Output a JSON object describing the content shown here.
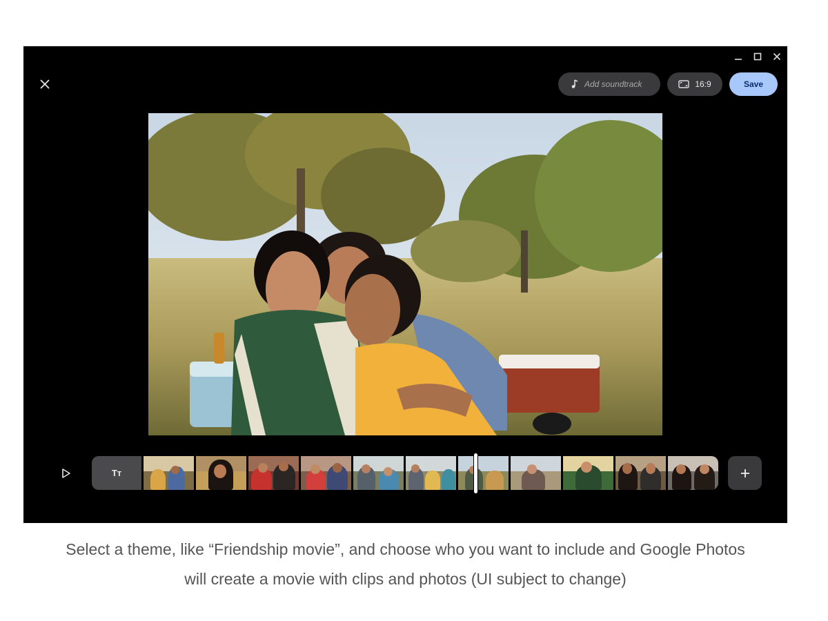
{
  "window": {
    "minimize_icon": "minimize-icon",
    "maximize_icon": "maximize-icon",
    "close_icon": "close-icon"
  },
  "editor": {
    "close_icon": "close-icon"
  },
  "toolbar": {
    "soundtrack_label": "Add soundtrack",
    "soundtrack_icon": "music-note-icon",
    "aspect_label": "16:9",
    "aspect_icon": "aspect-ratio-icon",
    "save_label": "Save"
  },
  "preview": {
    "description_icon": "photo"
  },
  "timeline": {
    "play_icon": "play-icon",
    "text_clip_label": "Tт",
    "clip_count": 11,
    "add_icon": "plus-icon"
  },
  "colors": {
    "app_background": "#000000",
    "save_button": "#a8c7fa",
    "pill_background": "#3a3a3c",
    "caption_text": "#555555"
  },
  "caption": {
    "line1": "Select a theme, like “Friendship movie”, and choose who you want to include and Google Photos",
    "line2": "will create a movie with clips and photos (UI subject to change)"
  }
}
